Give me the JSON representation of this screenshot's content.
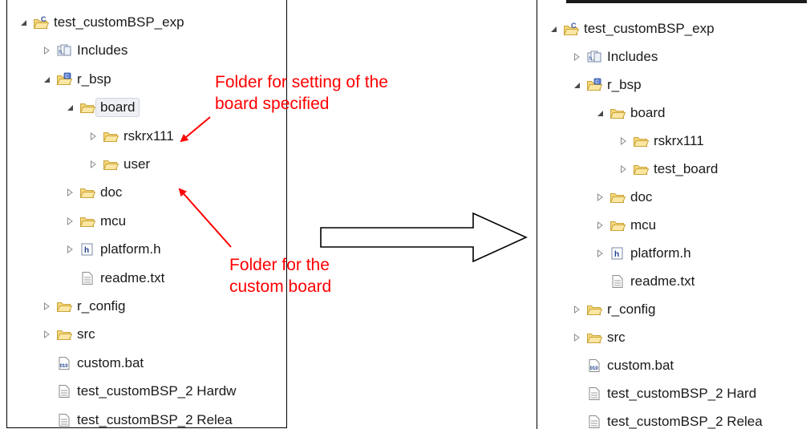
{
  "left_tree": {
    "items": [
      {
        "label": "test_customBSP_exp",
        "icon": "c-project-icon",
        "twisty": "expanded",
        "depth": 0
      },
      {
        "label": "Includes",
        "icon": "includes-icon",
        "twisty": "collapsed",
        "depth": 1
      },
      {
        "label": "r_bsp",
        "icon": "source-folder-icon",
        "twisty": "expanded",
        "depth": 1
      },
      {
        "label": "board",
        "icon": "folder-icon",
        "twisty": "expanded",
        "depth": 2,
        "selected": true
      },
      {
        "label": "rskrx111",
        "icon": "folder-icon",
        "twisty": "collapsed",
        "depth": 3
      },
      {
        "label": "user",
        "icon": "folder-icon",
        "twisty": "collapsed",
        "depth": 3
      },
      {
        "label": "doc",
        "icon": "folder-icon",
        "twisty": "collapsed",
        "depth": 2
      },
      {
        "label": "mcu",
        "icon": "folder-icon",
        "twisty": "collapsed",
        "depth": 2
      },
      {
        "label": "platform.h",
        "icon": "header-file-icon",
        "twisty": "collapsed",
        "depth": 2
      },
      {
        "label": "readme.txt",
        "icon": "text-file-icon",
        "twisty": "none",
        "depth": 2
      },
      {
        "label": "r_config",
        "icon": "folder-icon",
        "twisty": "collapsed",
        "depth": 1
      },
      {
        "label": "src",
        "icon": "folder-icon",
        "twisty": "collapsed",
        "depth": 1
      },
      {
        "label": "custom.bat",
        "icon": "binary-file-icon",
        "twisty": "none",
        "depth": 1
      },
      {
        "label": "test_customBSP_2 Hardw",
        "icon": "text-file-icon",
        "twisty": "none",
        "depth": 1
      },
      {
        "label": "test_customBSP_2 Relea",
        "icon": "text-file-icon",
        "twisty": "none",
        "depth": 1
      }
    ]
  },
  "right_tree": {
    "items": [
      {
        "label": "test_customBSP_exp",
        "icon": "c-project-icon",
        "twisty": "expanded",
        "depth": 0
      },
      {
        "label": "Includes",
        "icon": "includes-icon",
        "twisty": "collapsed",
        "depth": 1
      },
      {
        "label": "r_bsp",
        "icon": "source-folder-icon",
        "twisty": "expanded",
        "depth": 1
      },
      {
        "label": "board",
        "icon": "folder-icon",
        "twisty": "expanded",
        "depth": 2
      },
      {
        "label": "rskrx111",
        "icon": "folder-icon",
        "twisty": "collapsed",
        "depth": 3
      },
      {
        "label": "test_board",
        "icon": "folder-icon",
        "twisty": "collapsed",
        "depth": 3
      },
      {
        "label": "doc",
        "icon": "folder-icon",
        "twisty": "collapsed",
        "depth": 2
      },
      {
        "label": "mcu",
        "icon": "folder-icon",
        "twisty": "collapsed",
        "depth": 2
      },
      {
        "label": "platform.h",
        "icon": "header-file-icon",
        "twisty": "collapsed",
        "depth": 2
      },
      {
        "label": "readme.txt",
        "icon": "text-file-icon",
        "twisty": "none",
        "depth": 2
      },
      {
        "label": "r_config",
        "icon": "folder-icon",
        "twisty": "collapsed",
        "depth": 1
      },
      {
        "label": "src",
        "icon": "folder-icon",
        "twisty": "collapsed",
        "depth": 1
      },
      {
        "label": "custom.bat",
        "icon": "binary-file-icon",
        "twisty": "none",
        "depth": 1
      },
      {
        "label": "test_customBSP_2 Hard",
        "icon": "text-file-icon",
        "twisty": "none",
        "depth": 1
      },
      {
        "label": "test_customBSP_2 Relea",
        "icon": "text-file-icon",
        "twisty": "none",
        "depth": 1
      }
    ]
  },
  "annotations": {
    "board_note_line1": "Folder for setting of the",
    "board_note_line2": "board specified",
    "custom_note_line1": "Folder for the",
    "custom_note_line2": "custom board"
  },
  "colors": {
    "annotation": "#ff0000",
    "folder_fill": "#f5d77a",
    "folder_stroke": "#c9a43a"
  }
}
